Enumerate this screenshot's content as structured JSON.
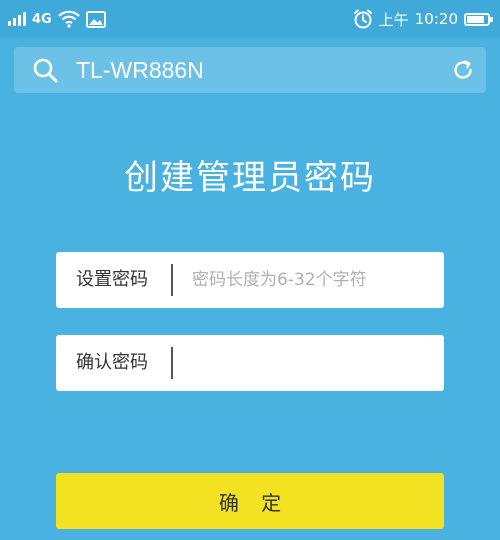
{
  "status_bar": {
    "network": "4G",
    "ampm": "上午",
    "time": "10:20",
    "battery_level": 0.85,
    "icons": [
      "signal-icon",
      "wifi-icon",
      "image-icon",
      "alarm-icon",
      "battery-icon"
    ]
  },
  "address_bar": {
    "text": "TL-WR886N",
    "icons": [
      "search-icon",
      "refresh-icon"
    ]
  },
  "page": {
    "title": "创建管理员密码"
  },
  "form": {
    "set_password": {
      "label": "设置密码",
      "placeholder": "密码长度为6-32个字符",
      "value": ""
    },
    "confirm_password": {
      "label": "确认密码",
      "placeholder": "",
      "value": ""
    },
    "submit_label": "确 定"
  },
  "colors": {
    "background": "#4ab2e0",
    "status_bar": "#3fa9da",
    "address_bar": "#6cc1e6",
    "button": "#f3e221",
    "text_light": "#ffffff"
  }
}
